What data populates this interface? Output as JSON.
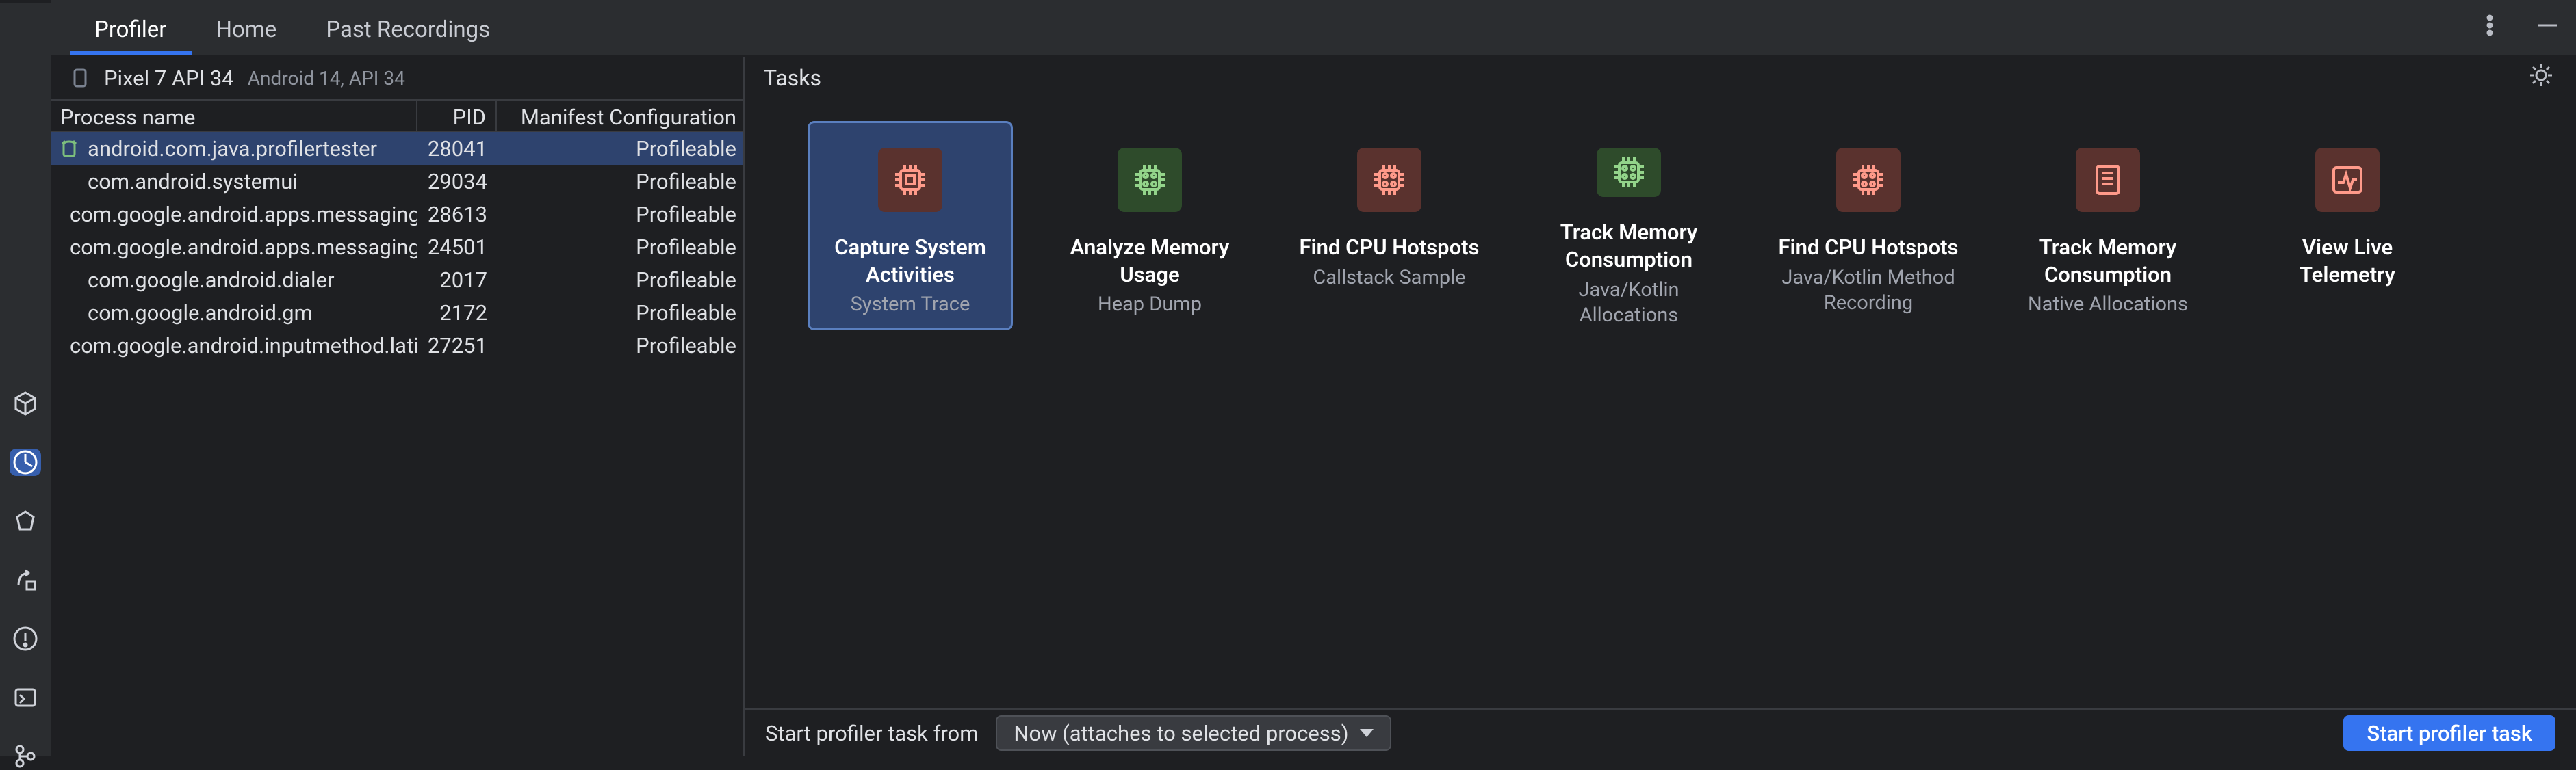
{
  "tabs": {
    "profiler": "Profiler",
    "home": "Home",
    "past": "Past Recordings"
  },
  "device": {
    "name": "Pixel 7 API 34",
    "meta": "Android 14, API 34"
  },
  "columns": {
    "name": "Process name",
    "pid": "PID",
    "cfg": "Manifest Configuration"
  },
  "processes": [
    {
      "name": "android.com.java.profilertester",
      "pid": "28041",
      "cfg": "Profileable",
      "selected": true
    },
    {
      "name": "com.android.systemui",
      "pid": "29034",
      "cfg": "Profileable"
    },
    {
      "name": "com.google.android.apps.messaging",
      "pid": "28613",
      "cfg": "Profileable"
    },
    {
      "name": "com.google.android.apps.messaging...",
      "pid": "24501",
      "cfg": "Profileable"
    },
    {
      "name": "com.google.android.dialer",
      "pid": "2017",
      "cfg": "Profileable"
    },
    {
      "name": "com.google.android.gm",
      "pid": "2172",
      "cfg": "Profileable"
    },
    {
      "name": "com.google.android.inputmethod.latin",
      "pid": "27251",
      "cfg": "Profileable"
    }
  ],
  "tasks_header": "Tasks",
  "tasks": {
    "capture": {
      "title": "Capture System Activities",
      "sub": "System Trace"
    },
    "memory": {
      "title": "Analyze Memory Usage",
      "sub": "Heap Dump"
    },
    "cpu1": {
      "title": "Find CPU Hotspots",
      "sub": "Callstack Sample"
    },
    "mem_jk": {
      "title": "Track Memory Consumption",
      "sub": "Java/Kotlin Allocations"
    },
    "cpu2": {
      "title": "Find CPU Hotspots",
      "sub": "Java/Kotlin Method Recording"
    },
    "mem_n": {
      "title": "Track Memory Consumption",
      "sub": "Native Allocations"
    },
    "telemetry": {
      "title": "View Live Telemetry",
      "sub": ""
    }
  },
  "bottom": {
    "label": "Start profiler task from",
    "dropdown": "Now (attaches to selected process)",
    "button": "Start profiler task"
  },
  "colors": {
    "orange": "#d76d5e",
    "green": "#73b36d"
  }
}
